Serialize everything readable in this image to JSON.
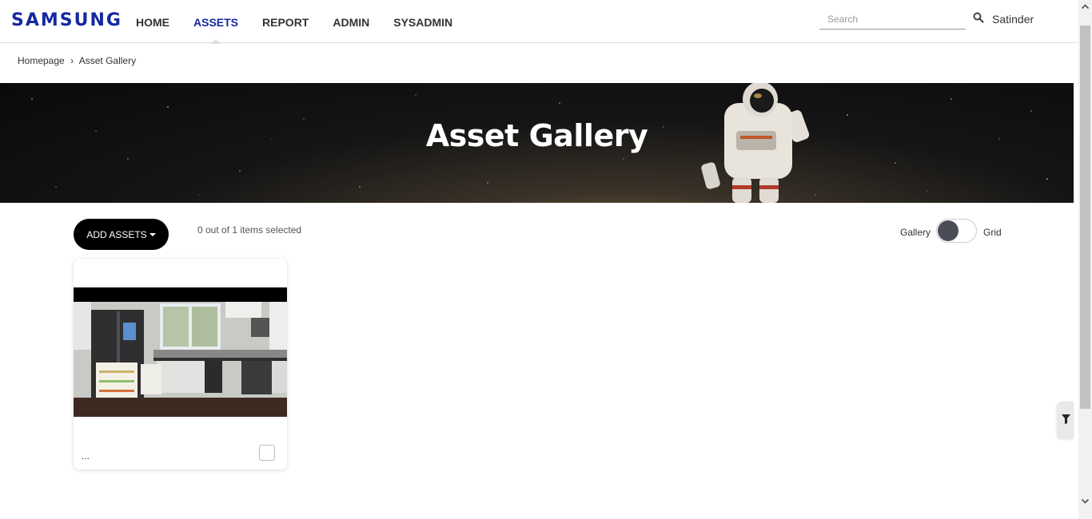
{
  "header": {
    "logo": "SAMSUNG",
    "nav": [
      "HOME",
      "ASSETS",
      "REPORT",
      "ADMIN",
      "SYSADMIN"
    ],
    "active_nav": "ASSETS",
    "search_placeholder": "Search",
    "user": "Satinder"
  },
  "breadcrumb": {
    "home": "Homepage",
    "separator": "›",
    "current": "Asset Gallery"
  },
  "banner": {
    "title": "Asset Gallery"
  },
  "toolbar": {
    "add_assets_label": "ADD ASSETS",
    "selection_status": "0 out of 1 items selected",
    "view_left": "Gallery",
    "view_right": "Grid"
  },
  "assets": [
    {
      "title": "...",
      "image": "kitchen-refrigerator-photo",
      "checked": false
    }
  ],
  "colors": {
    "brand": "#1428a0",
    "button": "#000000",
    "toggle_knob": "#4a4d55"
  },
  "icons": [
    "search-icon",
    "filter-icon",
    "caret-down-icon",
    "scroll-up-arrow-icon",
    "scroll-down-arrow-icon"
  ]
}
